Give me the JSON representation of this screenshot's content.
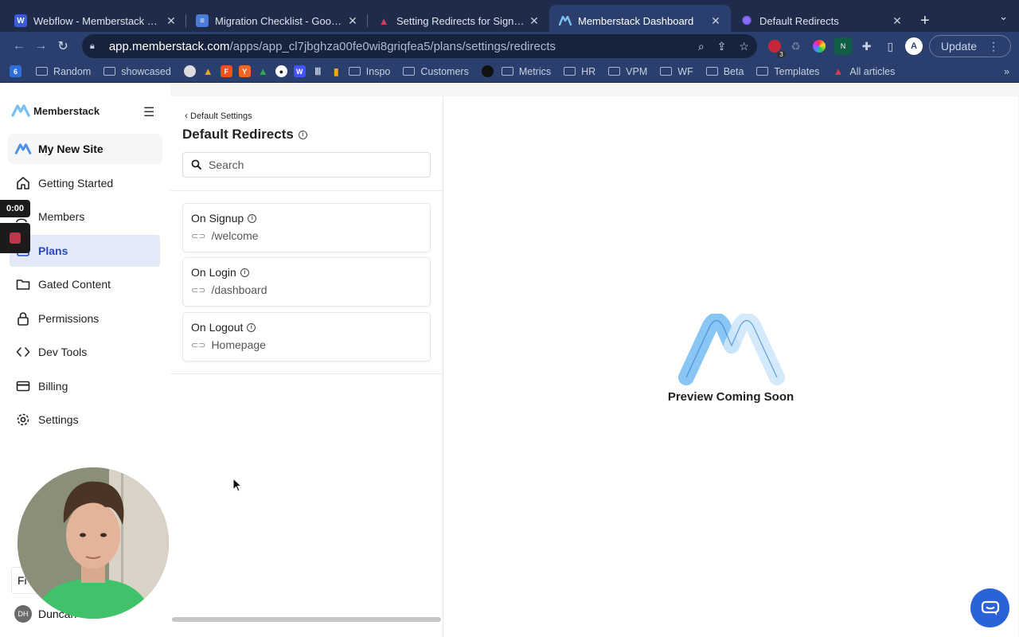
{
  "browser": {
    "tabs": [
      {
        "title": "Webflow - Memberstack Dashbo",
        "favicon": "W",
        "color": "#3b5bdb"
      },
      {
        "title": "Migration Checklist - Google D",
        "favicon": "≡",
        "color": "#4a7bd6"
      },
      {
        "title": "Setting Redirects for Signup, L",
        "favicon": "▲",
        "color": "#d43b55"
      },
      {
        "title": "Memberstack Dashboard",
        "favicon": "M",
        "color": "#4f8fe8"
      },
      {
        "title": "Default Redirects",
        "favicon": "✺",
        "color": "#7a5cff"
      }
    ],
    "active_tab": 3,
    "url_host": "app.memberstack.com",
    "url_path": "/apps/app_cl7jbghza00fe0wi8griqfea5/plans/settings/redirects",
    "update_label": "Update",
    "extension_badge": "3",
    "bookmarks": [
      "Random",
      "showcased",
      "Inspo",
      "Customers",
      "Metrics",
      "HR",
      "VPM",
      "WF",
      "Beta",
      "Templates",
      "All articles"
    ]
  },
  "sidebar": {
    "brand": "Memberstack",
    "site_name": "My New Site",
    "items": [
      {
        "label": "Getting Started",
        "icon": "home-icon"
      },
      {
        "label": "Members",
        "icon": "users-icon"
      },
      {
        "label": "Plans",
        "icon": "plans-icon"
      },
      {
        "label": "Gated Content",
        "icon": "folder-icon"
      },
      {
        "label": "Permissions",
        "icon": "lock-icon"
      },
      {
        "label": "Dev Tools",
        "icon": "code-icon"
      },
      {
        "label": "Billing",
        "icon": "credit-card-icon"
      },
      {
        "label": "Settings",
        "icon": "gear-icon"
      }
    ],
    "active_item": "Plans",
    "user_initials": "DH",
    "user_name": "Duncan",
    "footer_partial": "Fi"
  },
  "recorder": {
    "time": "0:00"
  },
  "panel": {
    "back_label": "Default Settings",
    "title": "Default Redirects",
    "search_placeholder": "Search",
    "redirects": [
      {
        "label": "On Signup",
        "path": "/welcome"
      },
      {
        "label": "On Login",
        "path": "/dashboard"
      },
      {
        "label": "On Logout",
        "path": "Homepage"
      }
    ]
  },
  "preview": {
    "text": "Preview Coming Soon"
  },
  "colors": {
    "accent": "#2548c9",
    "chat": "#2a62d8",
    "logo_blue": "#7cc0f2"
  }
}
